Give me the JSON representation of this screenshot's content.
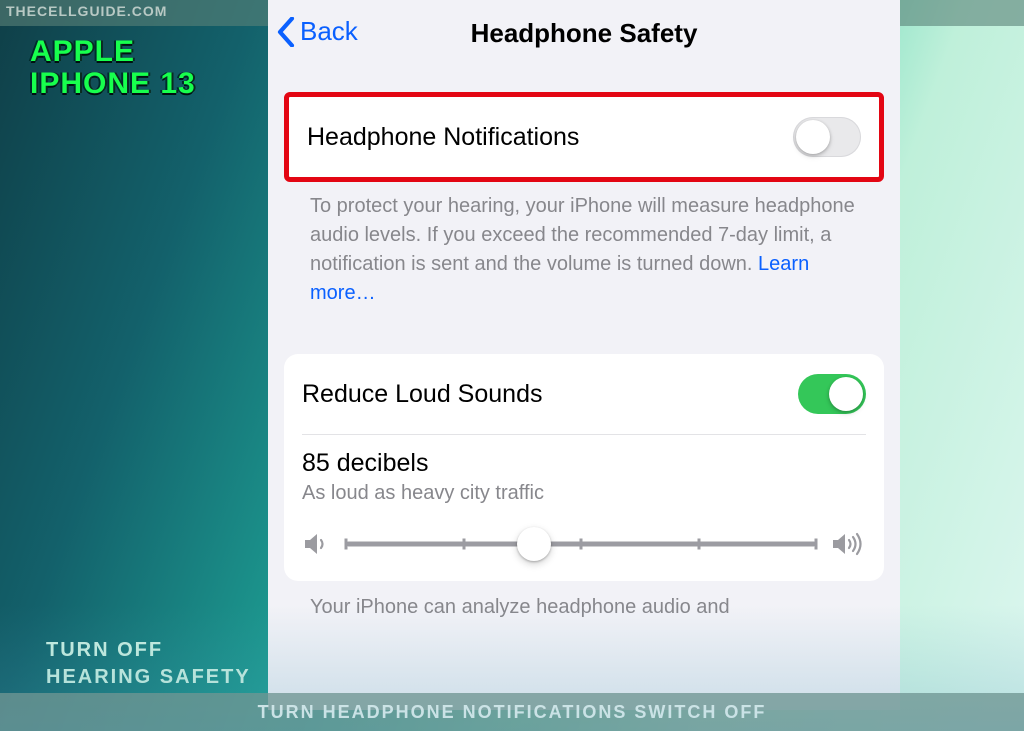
{
  "site_brand": "THECELLGUIDE.COM",
  "device_title_line1": "APPLE",
  "device_title_line2": "IPHONE 13",
  "bottom_label_line1": "TURN OFF",
  "bottom_label_line2": "HEARING SAFETY",
  "caption": "TURN HEADPHONE NOTIFICATIONS SWITCH OFF",
  "nav": {
    "back_label": "Back",
    "title": "Headphone Safety"
  },
  "section1": {
    "title": "Headphone Notifications",
    "toggle_on": false,
    "footer_text": "To protect your hearing, your iPhone will measure headphone audio levels. If you exceed the recommended 7-day limit, a notification is sent and the volume is turned down. ",
    "learn_more": "Learn more…"
  },
  "section2": {
    "title": "Reduce Loud Sounds",
    "toggle_on": true,
    "value_label": "85 decibels",
    "value_desc": "As loud as heavy city traffic",
    "slider_percent": 40,
    "footer_text": "Your iPhone can analyze headphone audio and"
  }
}
